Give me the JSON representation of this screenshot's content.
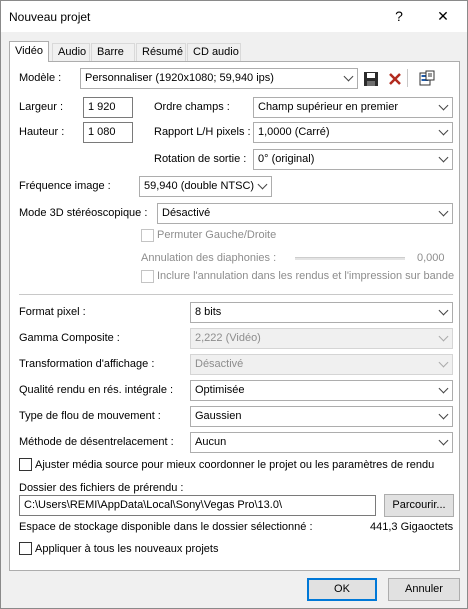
{
  "window": {
    "title": "Nouveau projet",
    "help": "?",
    "close": "✕"
  },
  "tabs": [
    {
      "label": "Vidéo",
      "active": true
    },
    {
      "label": "Audio"
    },
    {
      "label": "Barre"
    },
    {
      "label": "Résumé"
    },
    {
      "label": "CD audio"
    }
  ],
  "model": {
    "label": "Modèle :",
    "value": "Personnaliser (1920x1080; 59,940 ips)"
  },
  "icons": {
    "save": "save-icon",
    "delete": "delete-icon",
    "match": "match-media-icon"
  },
  "width": {
    "label": "Largeur :",
    "value": "1 920"
  },
  "height": {
    "label": "Hauteur :",
    "value": "1 080"
  },
  "field_order": {
    "label": "Ordre champs :",
    "value": "Champ supérieur en premier"
  },
  "pixel_ratio": {
    "label": "Rapport L/H pixels :",
    "value": "1,0000 (Carré)"
  },
  "rotation": {
    "label": "Rotation de sortie :",
    "value": "0° (original)"
  },
  "frame_rate": {
    "label": "Fréquence image :",
    "value": "59,940 (double NTSC)"
  },
  "stereo": {
    "label": "Mode 3D stéréoscopique :",
    "value": "Désactivé"
  },
  "swap_lr": {
    "label": "Permuter Gauche/Droite",
    "checked": false,
    "enabled": false
  },
  "crosstalk": {
    "label": "Annulation des diaphonies :",
    "value": "0,000",
    "slider_fraction": 0
  },
  "include_crosstalk": {
    "label": "Inclure l'annulation dans les rendus et l'impression sur bande",
    "checked": false,
    "enabled": false
  },
  "pixel_format": {
    "label": "Format pixel :",
    "value": "8 bits"
  },
  "gamma": {
    "label": "Gamma Composite :",
    "value": "2,222 (Vidéo)",
    "enabled": false
  },
  "view_transform": {
    "label": "Transformation d'affichage :",
    "value": "Désactivé",
    "enabled": false
  },
  "render_quality": {
    "label": "Qualité rendu en rés. intégrale :",
    "value": "Optimisée"
  },
  "motion_blur": {
    "label": "Type de flou de mouvement :",
    "value": "Gaussien"
  },
  "deinterlace": {
    "label": "Méthode de désentrelacement :",
    "value": "Aucun"
  },
  "adjust_media": {
    "label": "Ajuster média source pour mieux coordonner le projet ou les paramètres de rendu",
    "checked": false
  },
  "prerender_folder": {
    "label": "Dossier des fichiers de prérendu :",
    "value": "C:\\Users\\REMI\\AppData\\Local\\Sony\\Vegas Pro\\13.0\\",
    "browse": "Parcourir..."
  },
  "storage": {
    "label": "Espace de stockage disponible dans le dossier sélectionné :",
    "value": "441,3 Gigaoctets"
  },
  "apply_all": {
    "label": "Appliquer à tous les nouveaux projets",
    "checked": false
  },
  "buttons": {
    "ok": "OK",
    "cancel": "Annuler"
  }
}
